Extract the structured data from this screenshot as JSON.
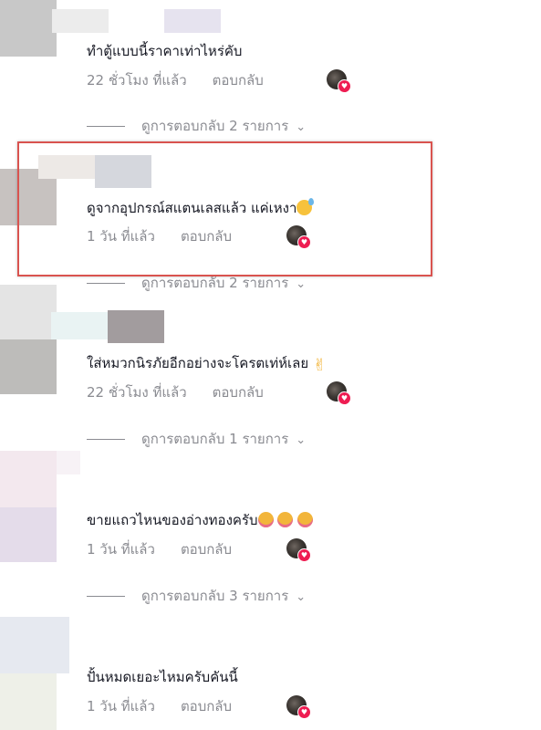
{
  "comments": [
    {
      "text": "ทำตู้แบบนี้ราคาเท่าไหร่คับ",
      "time": "22 ชั่วโมง ที่แล้ว",
      "reply": "ตอบกลับ",
      "view_replies": "ดูการตอบกลับ 2 รายการ"
    },
    {
      "text": "ดูจากอุปกรณ์สแตนเลสแล้ว แค่เหงา",
      "emoji": "sweat-smile-emoji",
      "time": "1 วัน ที่แล้ว",
      "reply": "ตอบกลับ",
      "view_replies": "ดูการตอบกลับ 2 รายการ"
    },
    {
      "text": "ใส่หมวกนิรภัยอีกอย่างจะโครตเท่ห์เลย",
      "emoji": "victory-hand-emoji",
      "time": "22 ชั่วโมง ที่แล้ว",
      "reply": "ตอบกลับ",
      "view_replies": "ดูการตอบกลับ 1 รายการ"
    },
    {
      "text": "ขายแถวไหนของอ่างทองครับ",
      "emoji": "smiling-hearts-emoji",
      "time": "1 วัน ที่แล้ว",
      "reply": "ตอบกลับ",
      "view_replies": "ดูการตอบกลับ 3 รายการ"
    },
    {
      "text": "ปั้นหมดเยอะไหมครับคันนี้",
      "time": "1 วัน ที่แล้ว",
      "reply": "ตอบกลับ"
    }
  ],
  "colors": {
    "text": "#161823",
    "muted": "#8a8b91",
    "like_heart": "#ee1d52",
    "highlight_border": "#d9534f"
  }
}
